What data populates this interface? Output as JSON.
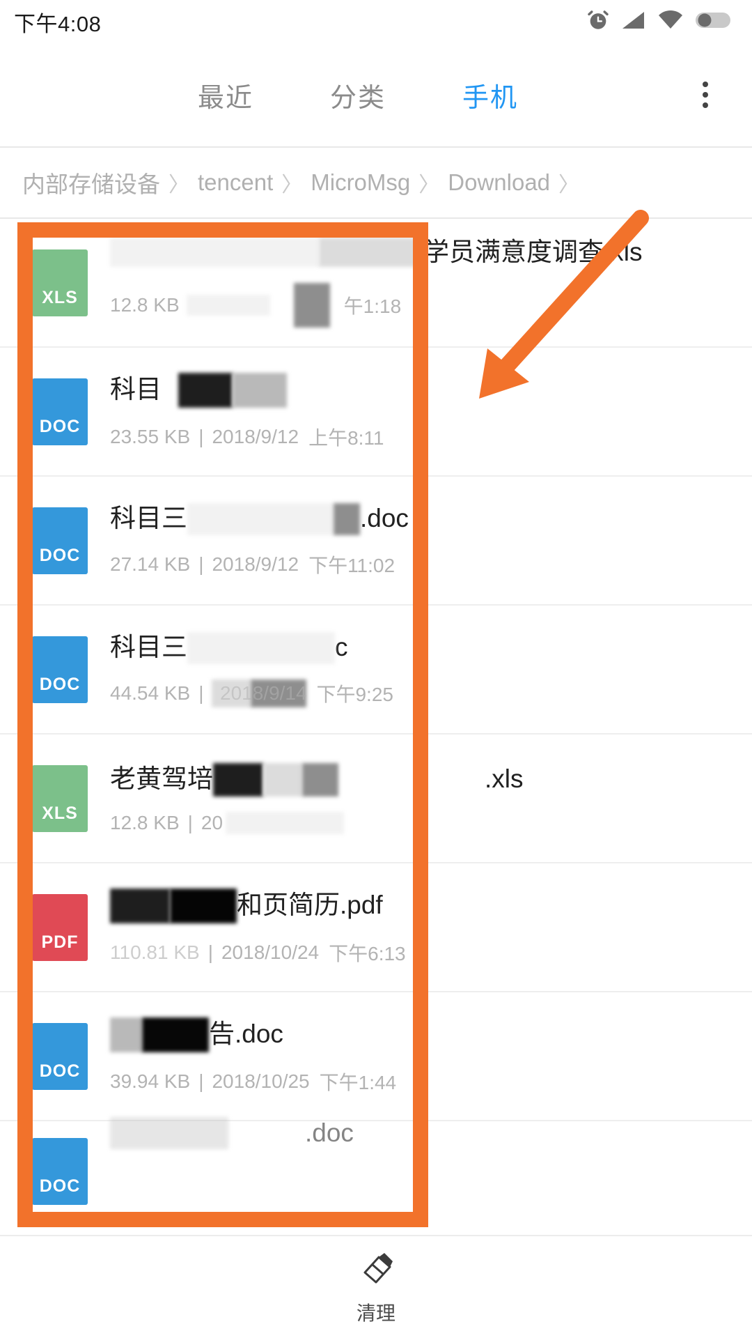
{
  "statusbar": {
    "time": "下午4:08",
    "icons": [
      "alarm-icon",
      "signal-icon",
      "wifi-icon",
      "battery-icon"
    ]
  },
  "header": {
    "tabs": [
      {
        "label": "最近",
        "active": false
      },
      {
        "label": "分类",
        "active": false
      },
      {
        "label": "手机",
        "active": true
      }
    ],
    "overflow_icon": "more-vertical-icon",
    "accent_color": "#2196f3"
  },
  "breadcrumb": {
    "items": [
      "内部存储设备",
      "tencent",
      "MicroMsg",
      "Download"
    ],
    "separator": "〉"
  },
  "files": [
    {
      "type": "XLS",
      "name_visible": "学员满意度调查.xls",
      "name_prefix_redacted": true,
      "size": "12.8 KB",
      "separator": "|",
      "date": "",
      "time": "午1:18",
      "meta_redacted": true
    },
    {
      "type": "DOC",
      "name_visible": "科目",
      "name_suffix_redacted": true,
      "size": "23.55 KB",
      "separator": "|",
      "date": "2018/9/12",
      "time": "上午8:11",
      "meta_redacted": true
    },
    {
      "type": "DOC",
      "name_visible": "科目三",
      "name_tail": ".doc",
      "name_middle_redacted": true,
      "size": "27.14 KB",
      "separator": "|",
      "date": "2018/9/12",
      "time": "下午11:02",
      "meta_redacted": true
    },
    {
      "type": "DOC",
      "name_visible": "科目三",
      "name_tail": "c",
      "name_middle_redacted": true,
      "size": "44.54 KB",
      "separator": "|",
      "date": "2018/9/14",
      "time": "下午9:25",
      "meta_redacted": true
    },
    {
      "type": "XLS",
      "name_visible": "老黄驾培",
      "name_tail": ".xls",
      "name_middle_redacted": true,
      "size": "12.8 KB",
      "separator": "|",
      "date": "20",
      "time": "",
      "meta_redacted": true
    },
    {
      "type": "PDF",
      "name_visible": "和页简历.pdf",
      "name_prefix_redacted": true,
      "size": "110.81 KB",
      "separator": "|",
      "date": "2018/10/24",
      "time": "下午6:13",
      "meta_redacted": true
    },
    {
      "type": "DOC",
      "name_visible": "告.doc",
      "name_prefix_redacted": true,
      "size": "39.94 KB",
      "separator": "|",
      "date": "2018/10/25",
      "time": "下午1:44",
      "meta_redacted": true
    },
    {
      "type": "DOC",
      "name_visible": ".doc",
      "name_prefix_redacted": true,
      "size": "",
      "separator": "",
      "date": "",
      "time": "",
      "meta_redacted": true
    }
  ],
  "bottombar": {
    "clean_icon": "eraser-icon",
    "clean_label": "清理"
  },
  "annotation": {
    "color": "#f2722b",
    "shapes": [
      "highlight-rectangle",
      "pointer-arrow"
    ]
  }
}
